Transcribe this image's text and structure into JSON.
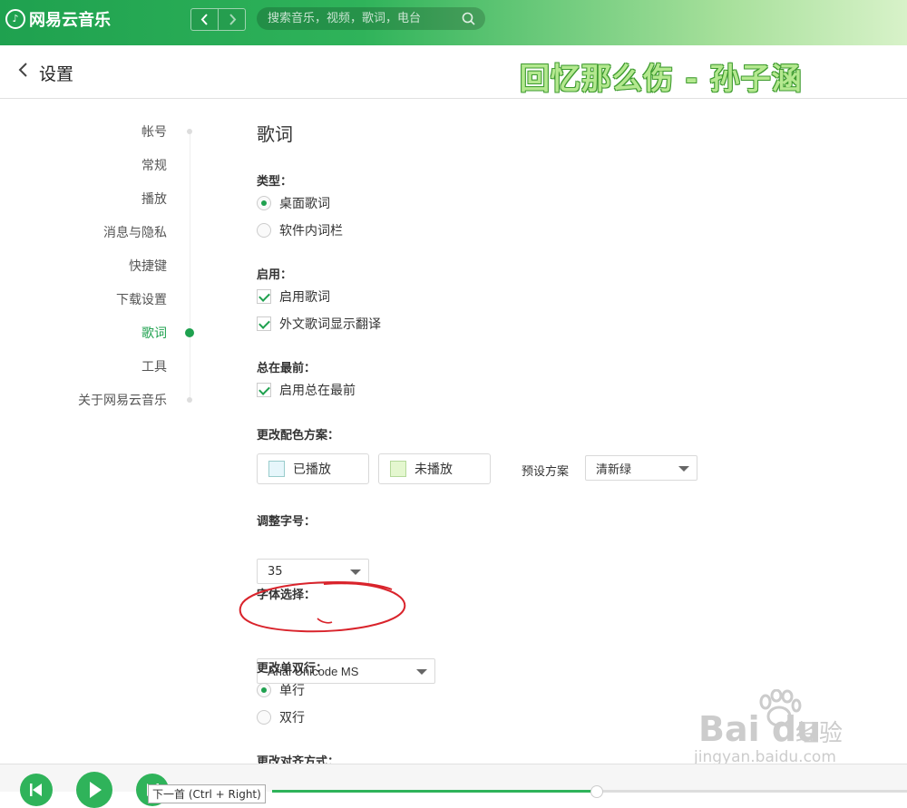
{
  "app": {
    "logo_text": "网易云音乐"
  },
  "search": {
    "placeholder": "搜索音乐，视频，歌词，电台"
  },
  "header": {
    "title": "设置",
    "overlay_title": "回忆那么伤 - 孙子涵"
  },
  "sidebar": {
    "items": [
      {
        "label": "帐号"
      },
      {
        "label": "常规"
      },
      {
        "label": "播放"
      },
      {
        "label": "消息与隐私"
      },
      {
        "label": "快捷键"
      },
      {
        "label": "下载设置"
      },
      {
        "label": "歌词",
        "active": true
      },
      {
        "label": "工具"
      },
      {
        "label": "关于网易云音乐"
      }
    ]
  },
  "lyrics": {
    "section_title": "歌词",
    "type": {
      "label": "类型：",
      "options": [
        {
          "label": "桌面歌词",
          "checked": true
        },
        {
          "label": "软件内词栏",
          "checked": false
        }
      ]
    },
    "enable": {
      "label": "启用：",
      "options": [
        {
          "label": "启用歌词",
          "checked": true
        },
        {
          "label": "外文歌词显示翻译",
          "checked": true
        }
      ]
    },
    "always_on_top": {
      "label": "总在最前：",
      "options": [
        {
          "label": "启用总在最前",
          "checked": true
        }
      ]
    },
    "color_scheme": {
      "label": "更改配色方案：",
      "played_label": "已播放",
      "played_color": "#e6f6fb",
      "unplayed_label": "未播放",
      "unplayed_color": "#e4f7cf",
      "preset_label": "预设方案",
      "preset_value": "清新绿"
    },
    "font_size": {
      "label": "调整字号：",
      "value": "35"
    },
    "font_family": {
      "label": "字体选择：",
      "value": "Arial Unicode MS"
    },
    "lines": {
      "label": "更改单双行：",
      "options": [
        {
          "label": "单行",
          "checked": true
        },
        {
          "label": "双行",
          "checked": false
        }
      ]
    },
    "alignment": {
      "label": "更改对齐方式："
    }
  },
  "watermark": {
    "brand": "Bai du",
    "sub": "经验",
    "url": "jingyan.baidu.com"
  },
  "player": {
    "tooltip": "下一首 (Ctrl + Right)",
    "progress": 0.51
  },
  "colors": {
    "accent": "#1fa14f",
    "annotation": "#d9232b"
  }
}
